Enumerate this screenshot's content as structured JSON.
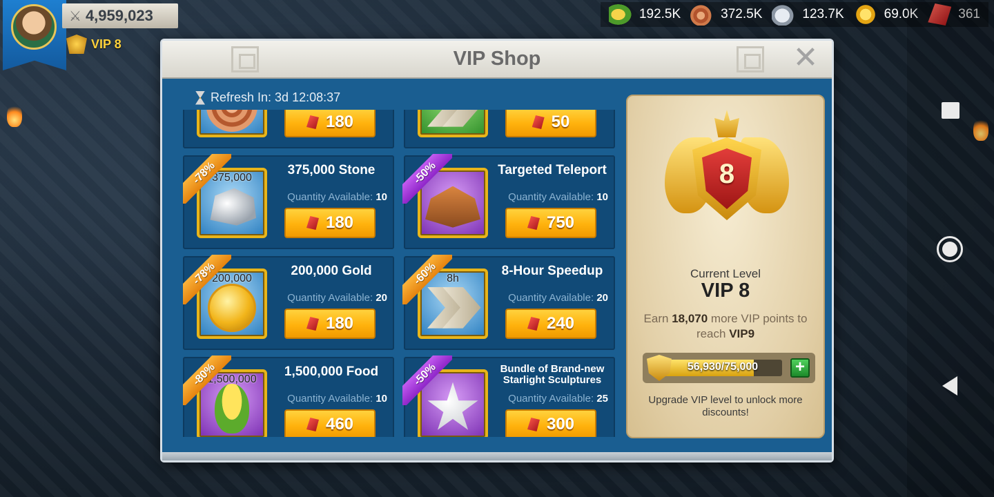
{
  "player": {
    "power": "4,959,023",
    "vip_label": "VIP 8"
  },
  "resources": [
    {
      "icon": "corn-icon",
      "value": "192.5K"
    },
    {
      "icon": "wood-icon",
      "value": "372.5K"
    },
    {
      "icon": "stone-icon",
      "value": "123.7K"
    },
    {
      "icon": "gold-icon",
      "value": "69.0K"
    },
    {
      "icon": "gem-icon",
      "value": "361"
    }
  ],
  "dialog": {
    "title": "VIP Shop",
    "refresh_label": "Refresh In: 3d 12:08:37",
    "close_symbol": "✕"
  },
  "shop": {
    "avail_label": "Quantity Available:",
    "items": [
      {
        "name": "",
        "discount": "",
        "qty": "",
        "available": "",
        "price": "180",
        "art": "wood",
        "bg": "blue"
      },
      {
        "name": "",
        "discount": "",
        "qty": "",
        "available": "",
        "price": "50",
        "art": "speed",
        "bg": "green"
      },
      {
        "name": "375,000 Stone",
        "discount": "-78%",
        "ribbon": "orange",
        "qty": "375,000",
        "available": "10",
        "price": "180",
        "art": "stone",
        "bg": "blue"
      },
      {
        "name": "Targeted Teleport",
        "discount": "-50%",
        "ribbon": "purple",
        "qty": "",
        "available": "10",
        "price": "750",
        "art": "tele",
        "bg": "purple"
      },
      {
        "name": "200,000 Gold",
        "discount": "-78%",
        "ribbon": "orange",
        "qty": "200,000",
        "available": "20",
        "price": "180",
        "art": "gold",
        "bg": "blue"
      },
      {
        "name": "8-Hour Speedup",
        "discount": "-60%",
        "ribbon": "orange",
        "qty": "8h",
        "available": "20",
        "price": "240",
        "art": "speed",
        "bg": "blue"
      },
      {
        "name": "1,500,000 Food",
        "discount": "-80%",
        "ribbon": "orange",
        "qty": "1,500,000",
        "available": "10",
        "price": "460",
        "art": "corn",
        "bg": "purple"
      },
      {
        "name": "Bundle of Brand-new Starlight Sculptures",
        "discount": "-50%",
        "ribbon": "purple",
        "qty": "",
        "available": "25",
        "price": "300",
        "art": "star",
        "bg": "purple",
        "small": true
      }
    ]
  },
  "vip": {
    "emblem_number": "8",
    "current_label": "Current Level",
    "current_level": "VIP 8",
    "earn_prefix": "Earn",
    "earn_points": "18,070",
    "earn_middle": "more VIP points to reach",
    "earn_target": "VIP9",
    "progress_text": "56,930/75,000",
    "progress_fraction": 0.759,
    "add_symbol": "+",
    "upgrade_text": "Upgrade VIP level to unlock more discounts!"
  }
}
